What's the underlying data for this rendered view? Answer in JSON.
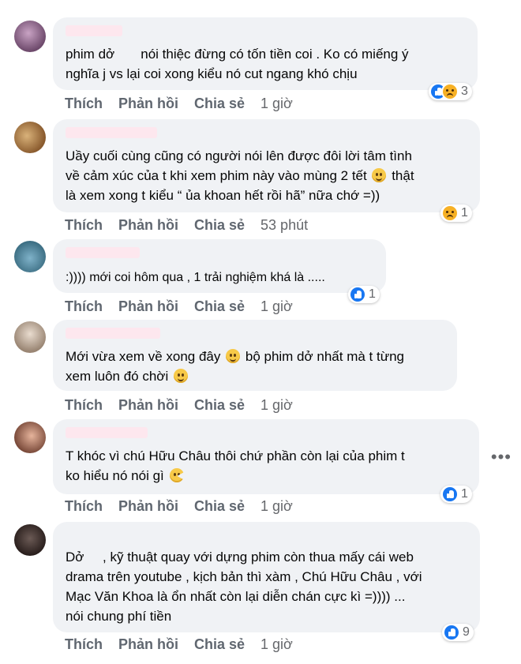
{
  "actions": {
    "like": "Thích",
    "reply": "Phản hồi",
    "share": "Chia sẻ"
  },
  "more_icon": "more-horizontal-icon",
  "comments": [
    {
      "lines": [
        "phim dở       nói thiệc đừng có tốn tiền coi . Ko có miếng ý",
        "nghĩa j vs lại coi xong kiểu nó cut ngang khó chịu"
      ],
      "reactions": [
        "like",
        "sad"
      ],
      "reaction_count": "3",
      "time": "1 giờ"
    },
    {
      "lines": [
        "Uầy cuối cùng cũng có người nói lên được đôi lời tâm tình",
        "về cảm xúc của t khi xem phim này vào mùng 2 tết",
        "là xem xong t kiểu “ ủa khoan hết rồi hã” nữa chớ =))"
      ],
      "line2_suffix": "thật",
      "reactions": [
        "sad"
      ],
      "reaction_count": "1",
      "time": "53 phút"
    },
    {
      "lines": [
        ":)))) mới coi hôm qua , 1 trải nghiệm khá là ....."
      ],
      "reactions": [
        "like"
      ],
      "reaction_count": "1",
      "time": "1 giờ"
    },
    {
      "lines": [
        "Mới vừa xem về xong đây",
        "bộ phim dở nhất mà t từng",
        "xem luôn đó chời"
      ],
      "reactions": [],
      "reaction_count": "",
      "time": "1 giờ"
    },
    {
      "lines": [
        "T khóc vì chú Hữu Châu thôi chứ phần còn lại của phim t",
        "ko hiểu nó nói gì"
      ],
      "reactions": [
        "like"
      ],
      "reaction_count": "1",
      "time": "1 giờ"
    },
    {
      "lines": [
        "Dở     , kỹ thuật quay với dựng phim còn thua mấy cái web",
        "drama trên youtube , kịch bản thì xàm , Chú Hữu Châu , với",
        "Mạc Văn Khoa là ổn nhất còn lại diễn chán cực kì =)))) ...",
        "nói chung phí tiền"
      ],
      "reactions": [
        "like"
      ],
      "reaction_count": "9",
      "time": "1 giờ"
    }
  ],
  "colors": {
    "bubble": "#f0f2f5",
    "action_text": "#606770",
    "like_blue": "#1877f2"
  }
}
